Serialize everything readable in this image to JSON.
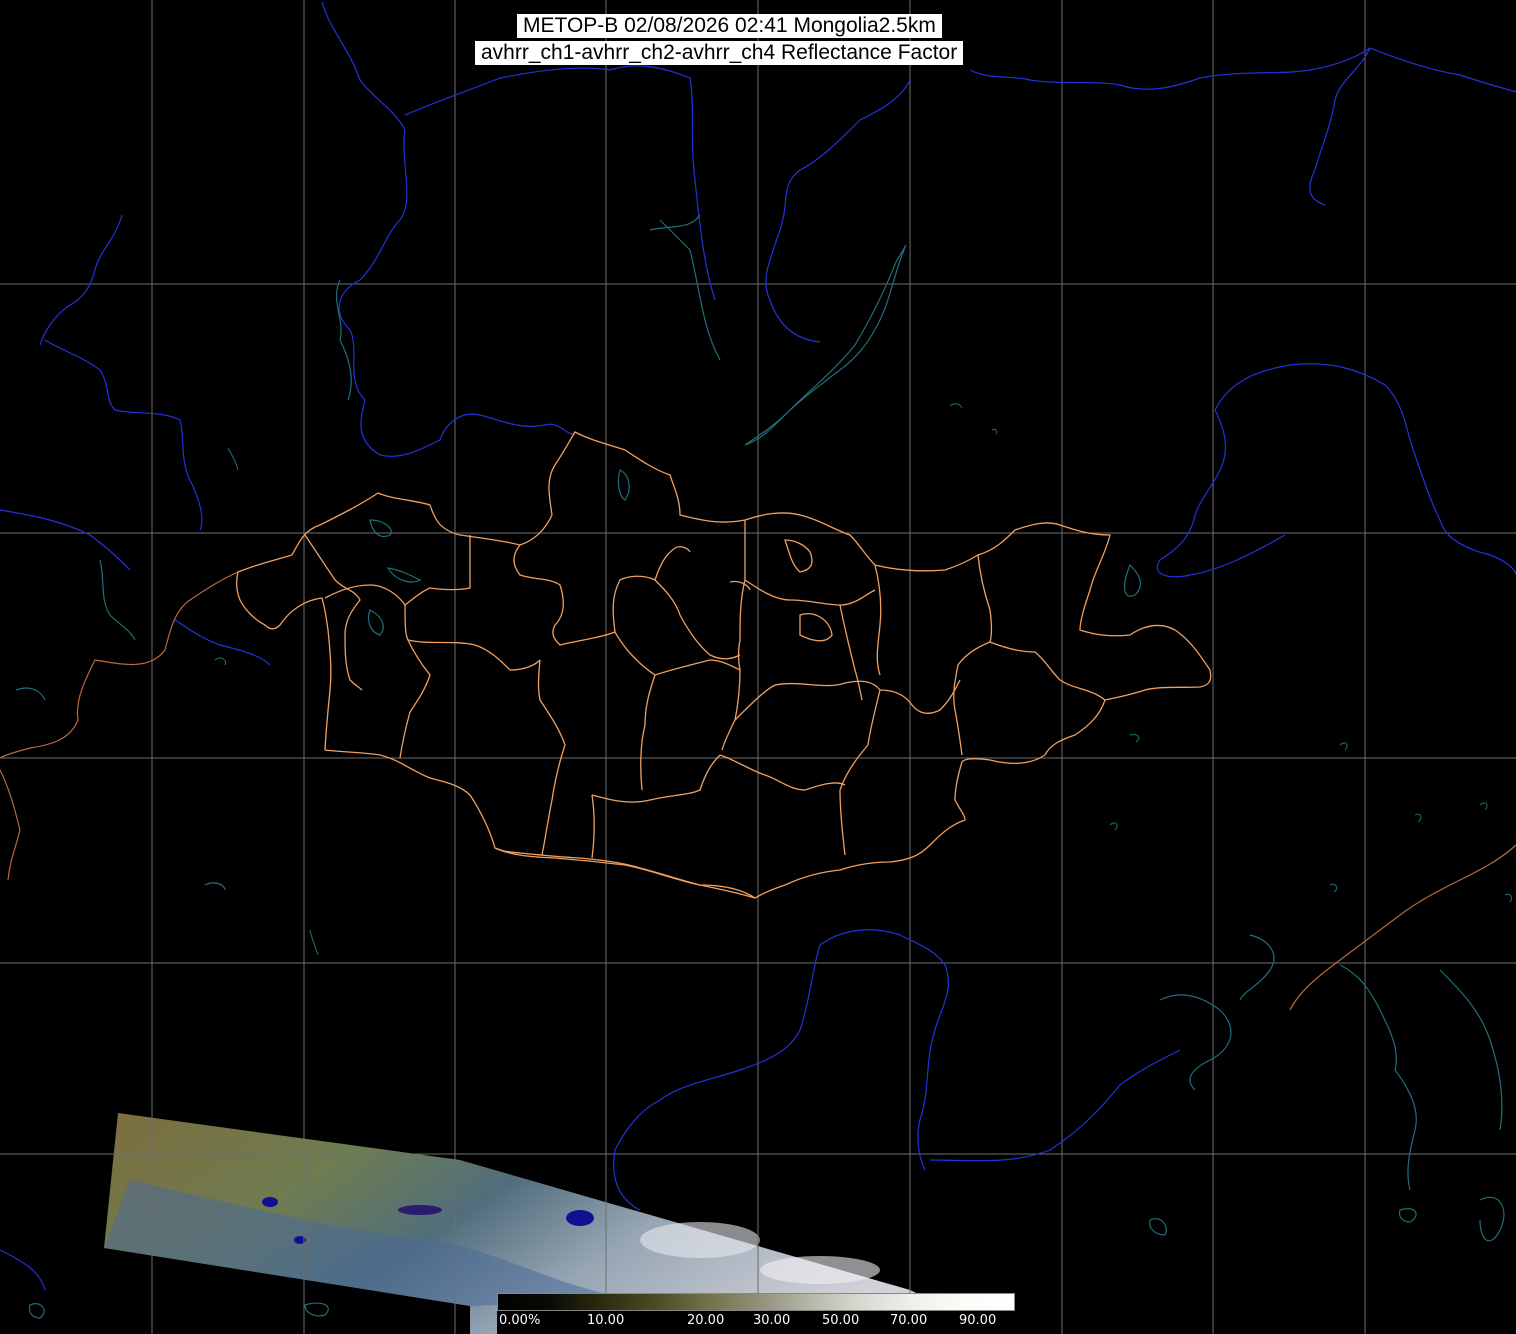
{
  "header": {
    "title_line1": "METOP-B 02/08/2026 02:41 Mongolia2.5km",
    "title_line2": "avhrr_ch1-avhrr_ch2-avhrr_ch4 Reflectance Factor"
  },
  "legend": {
    "tick_labels": [
      "0.00%",
      "10.00",
      "20.00",
      "30.00",
      "50.00",
      "70.00",
      "90.00"
    ]
  },
  "colors": {
    "background": "#000000",
    "graticule": "#7a7a7a",
    "coastline_rivers": "#2233dd",
    "lakes": "#1f6f7a",
    "mongolia_provinces": "#f0a060",
    "other_borders": "#c07040"
  }
}
